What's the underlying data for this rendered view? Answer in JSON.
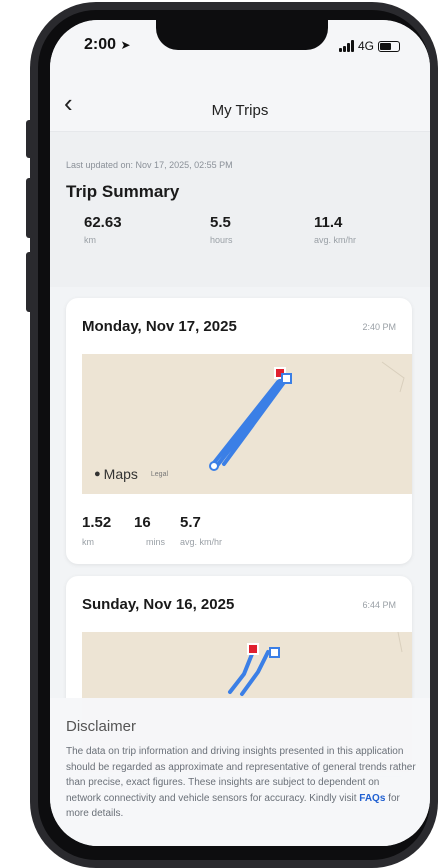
{
  "status": {
    "time": "2:00",
    "network": "4G"
  },
  "nav": {
    "back": "‹",
    "title": "My Trips"
  },
  "summary": {
    "updated": "Last updated on: Nov 17, 2025, 02:55 PM",
    "title": "Trip Summary",
    "stats": [
      {
        "value": "62.63",
        "unit": "km"
      },
      {
        "value": "5.5",
        "unit": "hours"
      },
      {
        "value": "11.4",
        "unit": "avg. km/hr"
      }
    ]
  },
  "trips": [
    {
      "date": "Monday, Nov 17, 2025",
      "time": "2:40 PM",
      "map_brand": "Maps",
      "map_legal": "Legal",
      "stats": [
        {
          "value": "1.52",
          "unit": "km"
        },
        {
          "value": "16",
          "unit": "mins"
        },
        {
          "value": "5.7",
          "unit": "avg. km/hr"
        }
      ]
    },
    {
      "date": "Sunday, Nov 16, 2025",
      "time": "6:44 PM"
    }
  ],
  "disclaimer": {
    "title": "Disclaimer",
    "body": "The data on trip information and driving insights presented in this application should be regarded as approximate and representative of general trends rather than precise, exact figures. These insights are subject to dependent on network connectivity and vehicle sensors for accuracy. Kindly visit ",
    "link": "FAQs",
    "tail": " for more details."
  },
  "colors": {
    "route": "#3b7fe6",
    "start_marker": "#3b7fe6",
    "end_marker": "#e0202e",
    "map_bg": "#ede4d4"
  }
}
